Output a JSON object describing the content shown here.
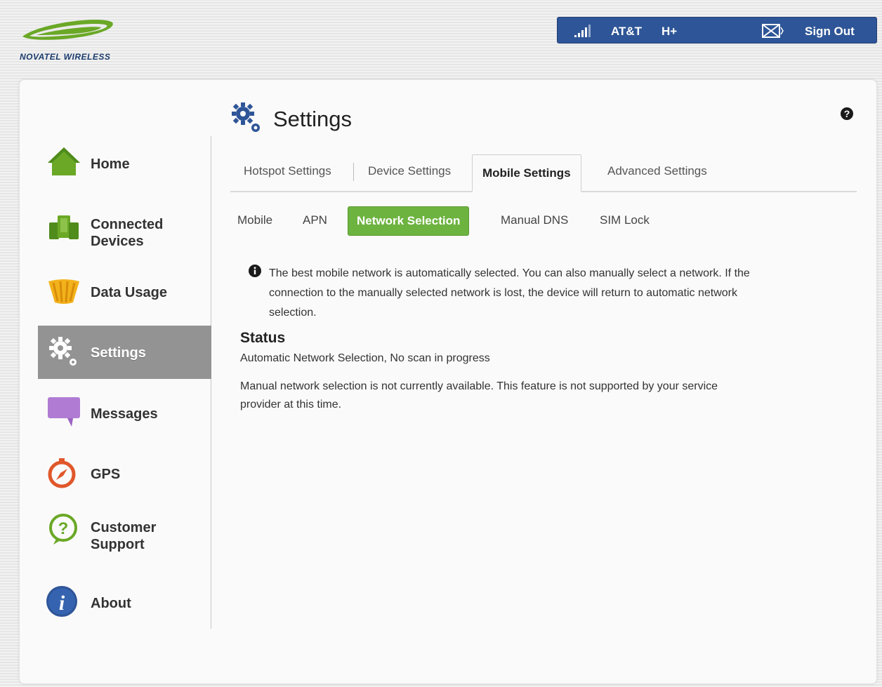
{
  "header": {
    "brand": "NOVATEL WIRELESS",
    "carrier": "AT&T",
    "network_type": "H+",
    "signout_label": "Sign Out"
  },
  "sidebar": {
    "items": [
      {
        "label": "Home",
        "icon": "home-icon"
      },
      {
        "label": "Connected Devices",
        "icon": "connected-devices-icon"
      },
      {
        "label": "Data Usage",
        "icon": "data-usage-icon"
      },
      {
        "label": "Settings",
        "icon": "gear-icon",
        "active": true
      },
      {
        "label": "Messages",
        "icon": "message-bubble-icon"
      },
      {
        "label": "GPS",
        "icon": "compass-icon"
      },
      {
        "label": "Customer Support",
        "icon": "support-icon"
      },
      {
        "label": "About",
        "icon": "info-icon"
      }
    ]
  },
  "main": {
    "title": "Settings",
    "tabs": [
      {
        "label": "Hotspot Settings"
      },
      {
        "label": "Device Settings"
      },
      {
        "label": "Mobile Settings",
        "active": true
      },
      {
        "label": "Advanced Settings"
      }
    ],
    "subtabs": [
      {
        "label": "Mobile"
      },
      {
        "label": "APN"
      },
      {
        "label": "Network Selection",
        "active": true
      },
      {
        "label": "Manual DNS"
      },
      {
        "label": "SIM Lock"
      }
    ],
    "info_line1": "The best mobile network is automatically selected. You can also manually select a network. If the",
    "info_line2": "connection to the manually selected network is lost, the device will return to automatic network",
    "info_line3": "selection.",
    "status_heading": "Status",
    "status_value": "Automatic Network Selection, No scan in progress",
    "notice_line1": "Manual network selection is not currently available. This feature is not supported by your service",
    "notice_line2": "provider at this time."
  },
  "colors": {
    "header_bar": "#2e5597",
    "active_nav": "#939393",
    "active_subtab": "#6db33f",
    "brand_green": "#6aa826"
  }
}
